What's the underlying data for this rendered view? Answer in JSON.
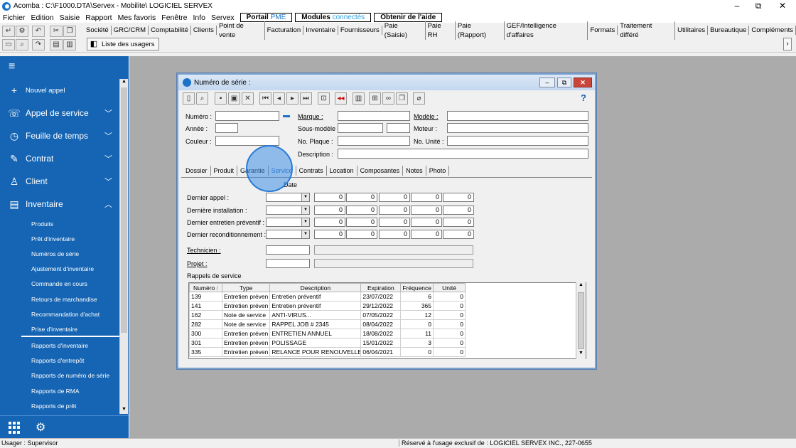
{
  "window": {
    "title": "Acomba : C:\\F1000.DTA\\Servex - Mobilite\\  LOGICIEL SERVEX",
    "minimize": "–",
    "maximize": "⧉",
    "close": "✕"
  },
  "menubar": {
    "items": [
      "Fichier",
      "Edition",
      "Saisie",
      "Rapport",
      "Mes favoris",
      "Fenêtre",
      "Info",
      "Servex"
    ],
    "portal_pme_a": "Portail ",
    "portal_pme_b": "PME",
    "modules_a": "Modules ",
    "modules_b": "connectés",
    "help": "Obtenir de l'aide"
  },
  "toolbar": {
    "modules": [
      "Société",
      "GRC/CRM",
      "Comptabilité",
      "Clients",
      "Point de vente",
      "Facturation",
      "Inventaire",
      "Fournisseurs",
      "Paie (Saisie)",
      "Paie RH",
      "Paie (Rapport)",
      "GEF/Intelligence d'affaires",
      "Formats",
      "Traitement différé",
      "Utilitaires",
      "Bureautique",
      "Compléments"
    ],
    "users_list": "Liste des usagers"
  },
  "sidebar": {
    "new_call": "Nouvel appel",
    "service_call": "Appel de service",
    "timesheet": "Feuille de temps",
    "contract": "Contrat",
    "client": "Client",
    "inventory": "Inventaire",
    "subitems": [
      "Produits",
      "Prêt d'inventaire",
      "Numéros de série",
      "Ajustement d'inventaire",
      "Commande en cours",
      "Retours de marchandise",
      "Recommandation d'achat",
      "Prise d'inventaire",
      "Rapports d'inventaire",
      "Rapports d'entrepôt",
      "Rapports de numéro de série",
      "Rapports de RMA",
      "Rapports de prêt"
    ]
  },
  "statusbar": {
    "user": "Usager : Supervisor",
    "license": "Réservé à l'usage exclusif de : LOGICIEL SERVEX INC., 227-0655"
  },
  "dialog": {
    "title": "Numéro de série :",
    "help": "?",
    "fields": {
      "numero": "Numéro :",
      "annee": "Année :",
      "couleur": "Couleur :",
      "marque": "Marque :",
      "sous_modele": "Sous-modèle :",
      "no_plaque": "No. Plaque :",
      "description": "Description :",
      "modele": "Modèle :",
      "moteur": "Moteur :",
      "no_unite": "No. Unité :"
    },
    "tabs": [
      "Dossier",
      "Produit",
      "Garantie",
      "Service",
      "Contrats",
      "Location",
      "Composantes",
      "Notes",
      "Photo"
    ],
    "date_header": "Date",
    "rows": [
      {
        "label": "Dernier appel :",
        "values": [
          "0",
          "0",
          "0",
          "0",
          "0"
        ]
      },
      {
        "label": "Dernière installation :",
        "values": [
          "0",
          "0",
          "0",
          "0",
          "0"
        ]
      },
      {
        "label": "Dernier entretien préventif :",
        "values": [
          "0",
          "0",
          "0",
          "0",
          "0"
        ]
      },
      {
        "label": "Dernier reconditionnement :",
        "values": [
          "0",
          "0",
          "0",
          "0",
          "0"
        ]
      }
    ],
    "technicien": "Technicien :",
    "projet": "Projet :",
    "reminders_title": "Rappels de service",
    "grid": {
      "headers": [
        "Numéro",
        "Type",
        "Description",
        "Expiration",
        "Fréquence",
        "Unité"
      ],
      "sort_indicator": "/",
      "rows": [
        [
          "139",
          "Entretien préven",
          "Entretien préventif",
          "23/07/2022",
          "6",
          "0"
        ],
        [
          "141",
          "Entretien préven",
          "Entretien préventif",
          "29/12/2022",
          "365",
          "0"
        ],
        [
          "162",
          "Note de service",
          "ANTI-VIRUS...",
          "07/05/2022",
          "12",
          "0"
        ],
        [
          "282",
          "Note de service",
          "RAPPEL JOB # 2345",
          "08/04/2022",
          "0",
          "0"
        ],
        [
          "300",
          "Entretien préven",
          "ENTRETIEN ANNUEL",
          "18/08/2022",
          "11",
          "0"
        ],
        [
          "301",
          "Entretien préven",
          "POLISSAGE",
          "15/01/2022",
          "3",
          "0"
        ],
        [
          "335",
          "Entretien préven",
          "RELANCE POUR RENOUVELLEMENT",
          "06/04/2021",
          "0",
          "0"
        ]
      ]
    }
  }
}
